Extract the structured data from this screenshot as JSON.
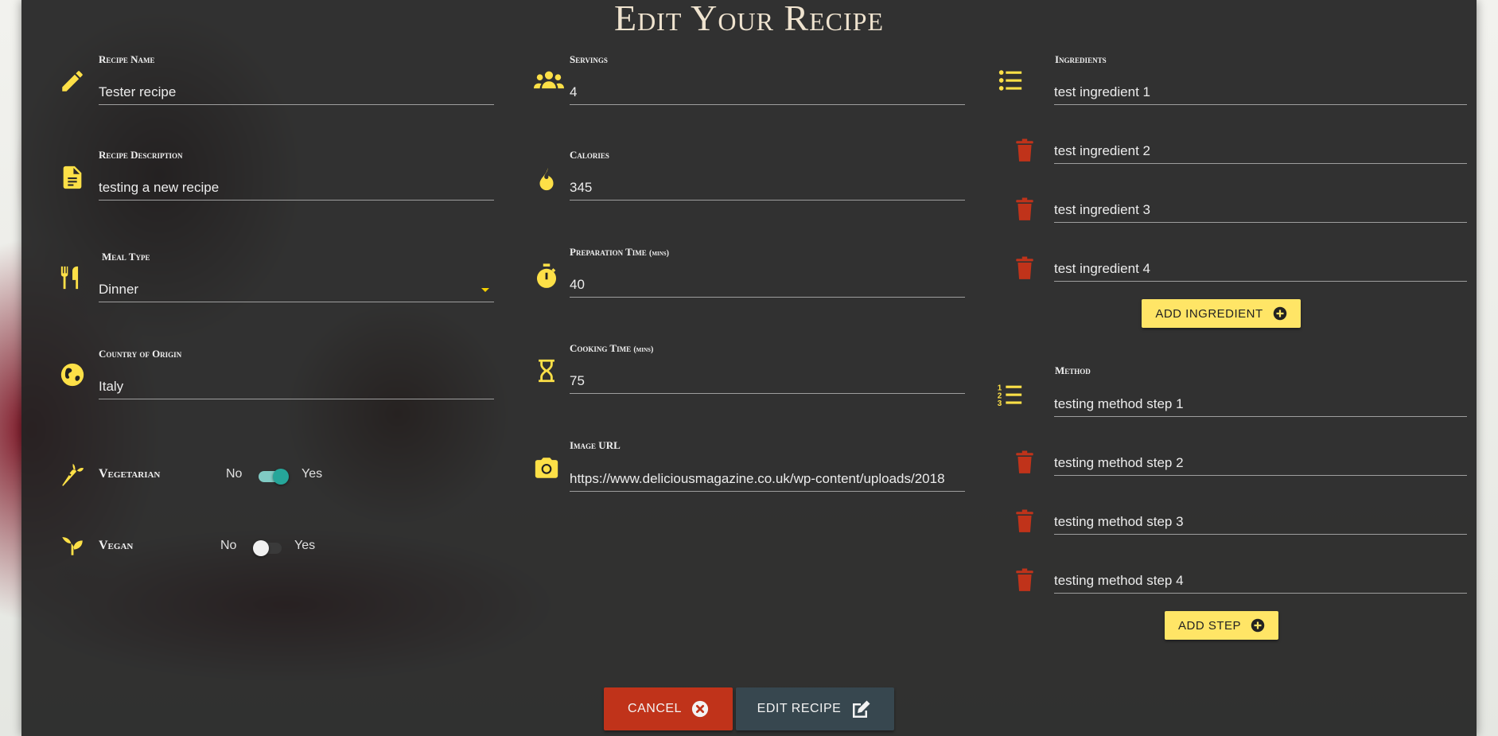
{
  "page_title": "Edit Your Recipe",
  "colors": {
    "accent_yellow": "#fde047",
    "delete_red": "#c0331a",
    "toggle_on": "#26a69a"
  },
  "left": {
    "recipe_name": {
      "label": "Recipe Name",
      "value": "Tester recipe",
      "icon": "pencil-icon"
    },
    "recipe_description": {
      "label": "Recipe Description",
      "value": "testing a new recipe",
      "icon": "document-icon"
    },
    "meal_type": {
      "label": "Meal Type",
      "value": "Dinner",
      "icon": "utensils-icon"
    },
    "country": {
      "label": "Country of Origin",
      "value": "Italy",
      "icon": "globe-icon"
    },
    "vegetarian": {
      "label": "Vegetarian",
      "no": "No",
      "yes": "Yes",
      "checked": true,
      "icon": "carrot-icon"
    },
    "vegan": {
      "label": "Vegan",
      "no": "No",
      "yes": "Yes",
      "checked": false,
      "icon": "seedling-icon"
    }
  },
  "middle": {
    "servings": {
      "label": "Servings",
      "value": "4",
      "icon": "users-icon"
    },
    "calories": {
      "label": "Calories",
      "value": "345",
      "icon": "fire-icon"
    },
    "prep_time": {
      "label": "Preparation Time",
      "unit": "(mins)",
      "value": "40",
      "icon": "stopwatch-icon"
    },
    "cook_time": {
      "label": "Cooking Time",
      "unit": "(mins)",
      "value": "75",
      "icon": "hourglass-icon"
    },
    "image_url": {
      "label": "Image URL",
      "value": "https://www.deliciousmagazine.co.uk/wp-content/uploads/2018",
      "icon": "camera-icon"
    }
  },
  "ingredients": {
    "label": "Ingredients",
    "items": [
      "test ingredient 1",
      "test ingredient 2",
      "test ingredient 3",
      "test ingredient 4"
    ],
    "add_label": "ADD INGREDIENT"
  },
  "method": {
    "label": "Method",
    "items": [
      "testing method step 1",
      "testing method step 2",
      "testing method step 3",
      "testing method step 4"
    ],
    "add_label": "ADD STEP"
  },
  "actions": {
    "cancel_label": "CANCEL",
    "edit_label": "EDIT RECIPE"
  }
}
